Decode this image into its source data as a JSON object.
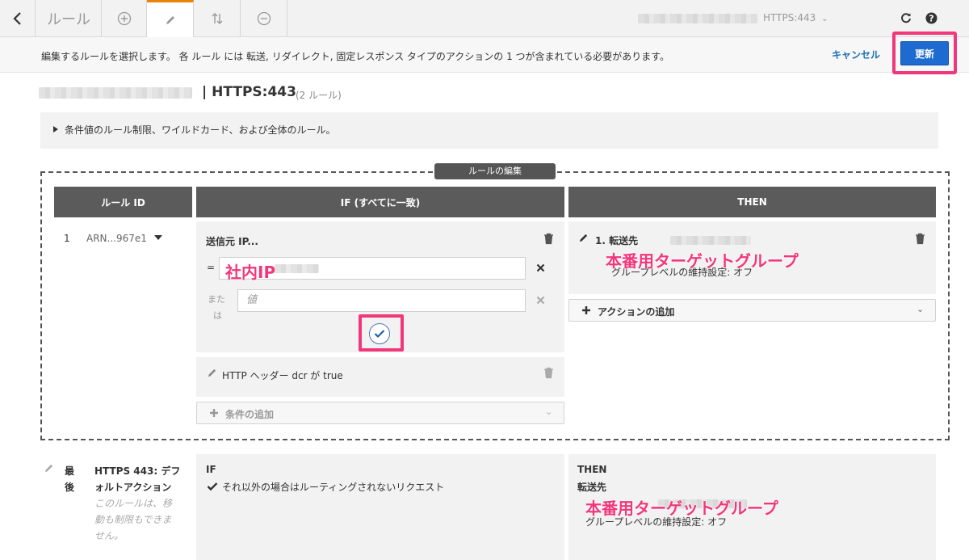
{
  "topbar": {
    "title": "ルール",
    "listener": "HTTPS:443",
    "icons": [
      "back-arrow-icon",
      "add-circle-icon",
      "pencil-icon",
      "sort-icon",
      "remove-circle-icon",
      "refresh-icon",
      "help-icon"
    ]
  },
  "infobar": {
    "message": "編集するルールを選択します。 各 ルール には 転送, リダイレクト, 固定レスポンス タイプのアクションの 1 つが含まれている必要があります。",
    "cancel_label": "キャンセル",
    "update_label": "更新"
  },
  "heading": {
    "listener": "| HTTPS:443",
    "rule_count": "(2 ルール)",
    "note": "条件値のルール制限、ワイルドカード、および全体のルール。"
  },
  "edit": {
    "label": "ルールの編集",
    "col_rule_id": "ルール ID",
    "col_if": "IF (すべてに一致)",
    "col_then": "THEN",
    "rule_number": "1",
    "rule_arn": "ARN...967e1",
    "condition_title": "送信元 IP...",
    "equals": "=",
    "value_annotation": "社内IP",
    "or_label_1": "また",
    "or_label_2": "は",
    "value_placeholder": "値",
    "header_condition": "HTTP ヘッダー dcr が true",
    "add_condition": "条件の追加",
    "action_title": "1.  転送先",
    "target_annotation": "本番用ターゲットグループ",
    "stickiness": "グループレベルの維持設定: オフ",
    "add_action": "アクションの追加"
  },
  "default_rule": {
    "label_1": "最",
    "label_2": "後",
    "title_1": "HTTPS 443: デフ",
    "title_2": "ォルトアクション",
    "desc_1": "このルールは、移",
    "desc_2": "動も制限もできま",
    "desc_3": "せん。",
    "if_label": "IF",
    "if_text": "それ以外の場合はルーティングされないリクエスト",
    "then_label": "THEN",
    "forward_label": "転送先",
    "target_annotation": "本番用ターゲットグループ",
    "stickiness": "グループレベルの維持設定: オフ"
  },
  "colors": {
    "highlight": "#f2367a",
    "primary": "#1d6ad1",
    "tab_accent": "#e8830c"
  }
}
